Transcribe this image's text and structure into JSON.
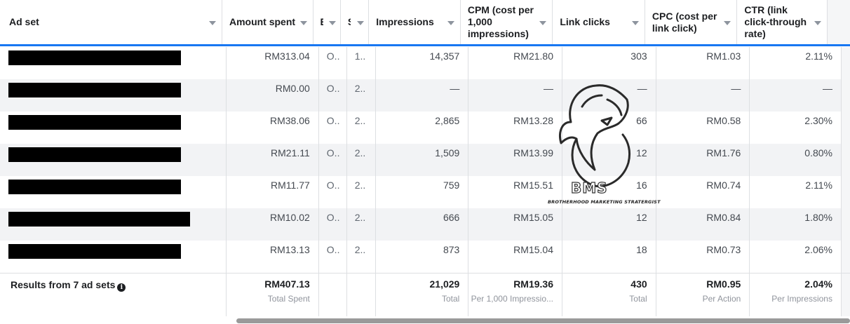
{
  "columns": [
    {
      "label": "Ad set"
    },
    {
      "label": "Amount spent"
    },
    {
      "label": "E"
    },
    {
      "label": "S"
    },
    {
      "label": "Impressions"
    },
    {
      "label": "CPM (cost per 1,000 impressions)"
    },
    {
      "label": "Link clicks"
    },
    {
      "label": "CPC (cost per link click)"
    },
    {
      "label": "CTR (link click-through rate)"
    }
  ],
  "rows": [
    {
      "redact_fraction": 0.76,
      "amount": "RM313.04",
      "e": "O..",
      "s": "1..",
      "impressions": "14,357",
      "cpm": "RM21.80",
      "clicks": "303",
      "cpc": "RM1.03",
      "ctr": "2.11%"
    },
    {
      "redact_fraction": 0.76,
      "amount": "RM0.00",
      "e": "O..",
      "s": "2..",
      "impressions": "—",
      "cpm": "—",
      "clicks": "—",
      "cpc": "—",
      "ctr": "—"
    },
    {
      "redact_fraction": 0.76,
      "amount": "RM38.06",
      "e": "O..",
      "s": "2..",
      "impressions": "2,865",
      "cpm": "RM13.28",
      "clicks": "66",
      "cpc": "RM0.58",
      "ctr": "2.30%"
    },
    {
      "redact_fraction": 0.76,
      "amount": "RM21.11",
      "e": "O..",
      "s": "2..",
      "impressions": "1,509",
      "cpm": "RM13.99",
      "clicks": "12",
      "cpc": "RM1.76",
      "ctr": "0.80%"
    },
    {
      "redact_fraction": 0.76,
      "amount": "RM11.77",
      "e": "O..",
      "s": "2..",
      "impressions": "759",
      "cpm": "RM15.51",
      "clicks": "16",
      "cpc": "RM0.74",
      "ctr": "2.11%"
    },
    {
      "redact_fraction": 0.8,
      "amount": "RM10.02",
      "e": "O..",
      "s": "2..",
      "impressions": "666",
      "cpm": "RM15.05",
      "clicks": "12",
      "cpc": "RM0.84",
      "ctr": "1.80%"
    },
    {
      "redact_fraction": 0.76,
      "amount": "RM13.13",
      "e": "O..",
      "s": "2..",
      "impressions": "873",
      "cpm": "RM15.04",
      "clicks": "18",
      "cpc": "RM0.73",
      "ctr": "2.06%"
    }
  ],
  "footer": {
    "label": "Results from 7 ad sets",
    "info_icon": "info-icon",
    "amount": {
      "value": "RM407.13",
      "sub": "Total Spent"
    },
    "impressions": {
      "value": "21,029",
      "sub": "Total"
    },
    "cpm": {
      "value": "RM19.36",
      "sub": "Per 1,000 Impressio..."
    },
    "clicks": {
      "value": "430",
      "sub": "Total"
    },
    "cpc": {
      "value": "RM0.95",
      "sub": "Per Action"
    },
    "ctr": {
      "value": "2.04%",
      "sub": "Per Impressions"
    }
  },
  "watermark": {
    "logo_text": "BMS",
    "tagline": "BROTHERHOOD MARKETING STRATERGIST",
    "icon": "wolf-head-logo"
  },
  "colors": {
    "accent": "#1877f2",
    "row_alt": "#f2f3f5",
    "border": "#dddfe2",
    "redaction": "#000000"
  }
}
